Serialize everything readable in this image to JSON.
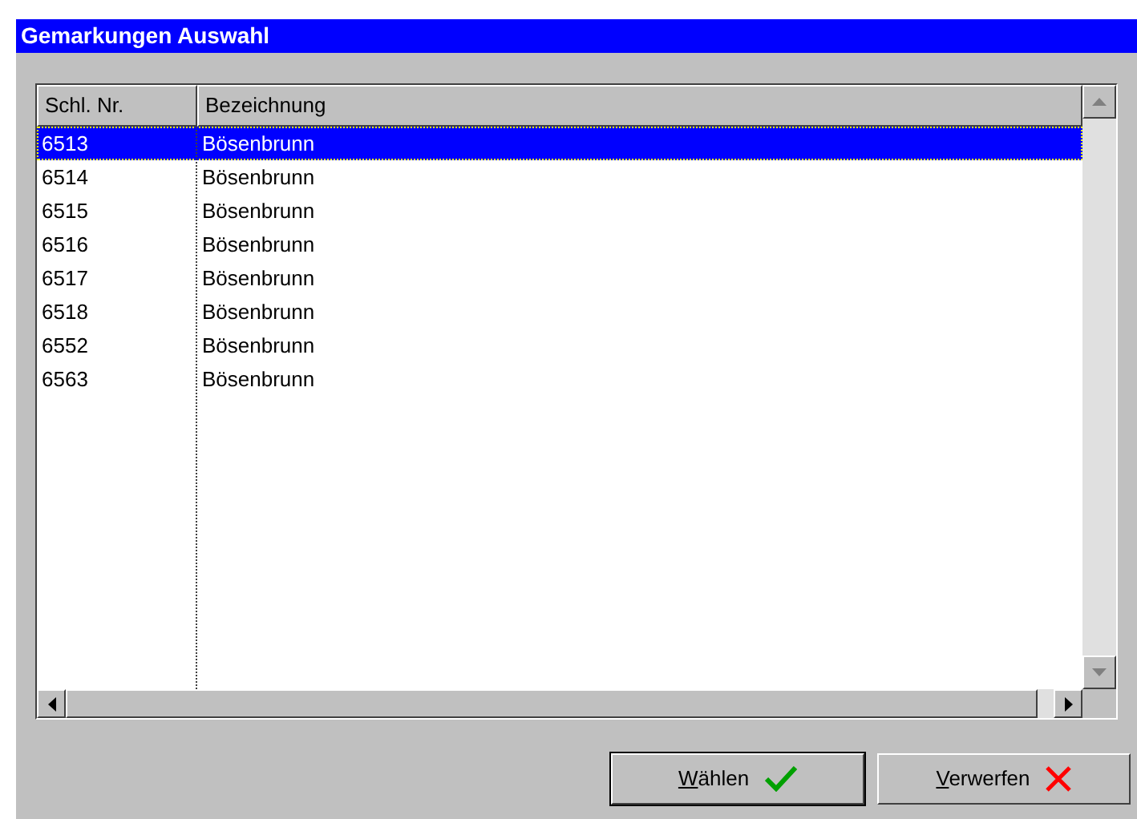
{
  "window": {
    "title": "Gemarkungen Auswahl"
  },
  "table": {
    "columns": [
      "Schl. Nr.",
      "Bezeichnung"
    ],
    "rows": [
      {
        "cells": [
          "6513",
          "Bösenbrunn"
        ],
        "selected": true
      },
      {
        "cells": [
          "6514",
          "Bösenbrunn"
        ],
        "selected": false
      },
      {
        "cells": [
          "6515",
          "Bösenbrunn"
        ],
        "selected": false
      },
      {
        "cells": [
          "6516",
          "Bösenbrunn"
        ],
        "selected": false
      },
      {
        "cells": [
          "6517",
          "Bösenbrunn"
        ],
        "selected": false
      },
      {
        "cells": [
          "6518",
          "Bösenbrunn"
        ],
        "selected": false
      },
      {
        "cells": [
          "6552",
          "Bösenbrunn"
        ],
        "selected": false
      },
      {
        "cells": [
          "6563",
          "Bösenbrunn"
        ],
        "selected": false
      }
    ]
  },
  "buttons": [
    {
      "mnemonic": "W",
      "label_rest": "ählen",
      "kind": "ok"
    },
    {
      "mnemonic": "V",
      "label_rest": "erwerfen",
      "kind": "cancel"
    }
  ]
}
